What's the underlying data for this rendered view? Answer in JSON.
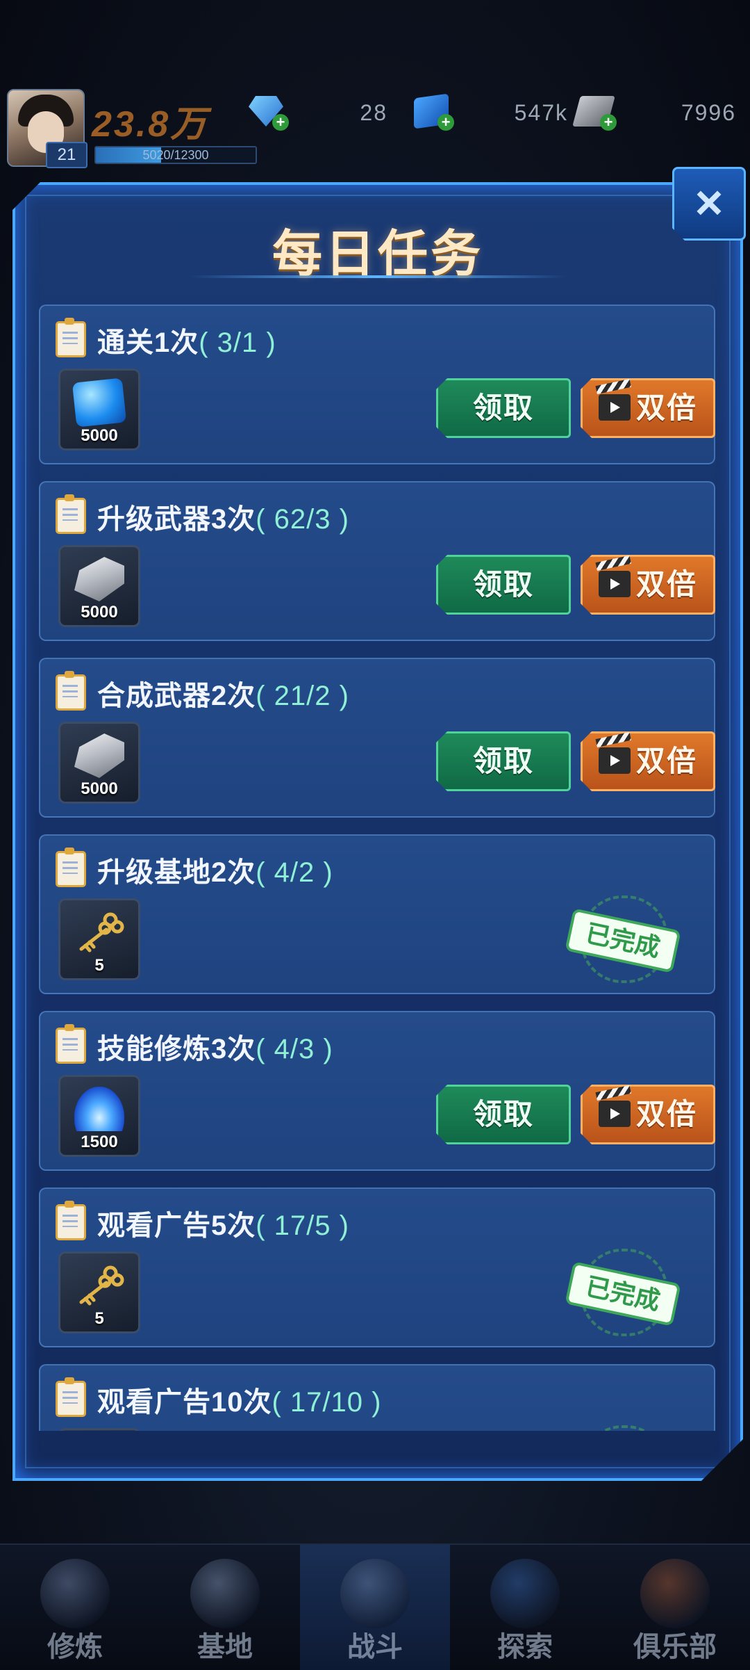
{
  "header": {
    "power": "23.8万",
    "level": "21",
    "exp_text": "5020/12300",
    "exp_fraction": 0.408,
    "resources": [
      {
        "icon": "diamond-icon",
        "value": "28"
      },
      {
        "icon": "blue-cube-icon",
        "value": "547k"
      },
      {
        "icon": "steel-ingot-icon",
        "value": "7996"
      }
    ]
  },
  "dialog": {
    "title": "每日任务",
    "close_label": "×",
    "buttons": {
      "claim": "领取",
      "double": "双倍",
      "completed": "已完成"
    },
    "tasks": [
      {
        "name": "通关1次",
        "progress": "( 3/1 )",
        "reward_icon": "blue-cube-icon",
        "reward_qty": "5000",
        "status": "claimable"
      },
      {
        "name": "升级武器3次",
        "progress": "( 62/3 )",
        "reward_icon": "steel-ingot-icon",
        "reward_qty": "5000",
        "status": "claimable"
      },
      {
        "name": "合成武器2次",
        "progress": "( 21/2 )",
        "reward_icon": "steel-ingot-icon",
        "reward_qty": "5000",
        "status": "claimable"
      },
      {
        "name": "升级基地2次",
        "progress": "( 4/2 )",
        "reward_icon": "gold-key-icon",
        "reward_qty": "5",
        "status": "completed"
      },
      {
        "name": "技能修炼3次",
        "progress": "( 4/3 )",
        "reward_icon": "blue-flame-icon",
        "reward_qty": "1500",
        "status": "claimable"
      },
      {
        "name": "观看广告5次",
        "progress": "( 17/5 )",
        "reward_icon": "gold-key-icon",
        "reward_qty": "5",
        "status": "completed"
      },
      {
        "name": "观看广告10次",
        "progress": "( 17/10 )",
        "reward_icon": "gold-key-icon",
        "reward_qty": "",
        "status": "completed"
      }
    ]
  },
  "nav": {
    "items": [
      {
        "label": "修炼",
        "icon": "orbs-icon"
      },
      {
        "label": "基地",
        "icon": "rocket-base-icon"
      },
      {
        "label": "战斗",
        "icon": "battle-gear-icon"
      },
      {
        "label": "探索",
        "icon": "galaxy-icon"
      },
      {
        "label": "俱乐部",
        "icon": "club-emblem-icon"
      }
    ],
    "active_index": 2
  },
  "colors": {
    "claim_button": "#1f8a5a",
    "double_button": "#e0782a",
    "progress_text": "#8ff0d5",
    "dialog_border": "#4aa8ff"
  }
}
